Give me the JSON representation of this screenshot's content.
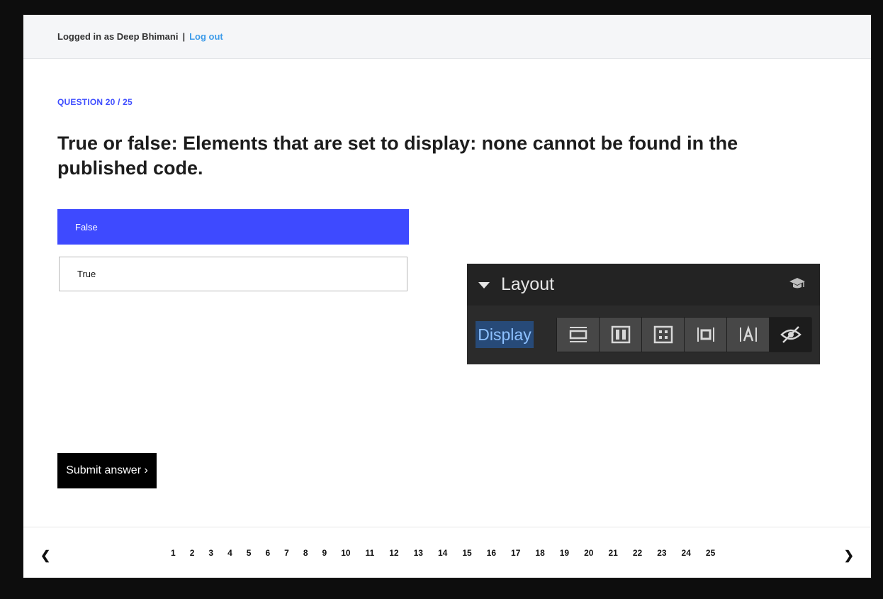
{
  "topbar": {
    "logged_in_text": "Logged in as Deep Bhimani",
    "separator": "|",
    "logout_label": "Log out"
  },
  "question": {
    "label": "QUESTION 20 / 25",
    "text": "True or false: Elements that are set to display: none cannot be found in the published code."
  },
  "options": [
    {
      "label": "False",
      "selected": true
    },
    {
      "label": "True",
      "selected": false
    }
  ],
  "image_panel": {
    "header": "Layout",
    "display_label": "Display",
    "buttons": [
      "display-block-icon",
      "display-flex-icon",
      "display-grid-icon",
      "display-inline-block-icon",
      "display-inline-icon",
      "display-none-icon"
    ]
  },
  "submit": {
    "label": "Submit answer ›"
  },
  "pagination": {
    "prev": "❮",
    "next": "❯",
    "pages": [
      "1",
      "2",
      "3",
      "4",
      "5",
      "6",
      "7",
      "8",
      "9",
      "10",
      "11",
      "12",
      "13",
      "14",
      "15",
      "16",
      "17",
      "18",
      "19",
      "20",
      "21",
      "22",
      "23",
      "24",
      "25"
    ]
  },
  "colors": {
    "accent": "#3e4aff",
    "link": "#3d9be9",
    "background": "#0d0d0d"
  }
}
